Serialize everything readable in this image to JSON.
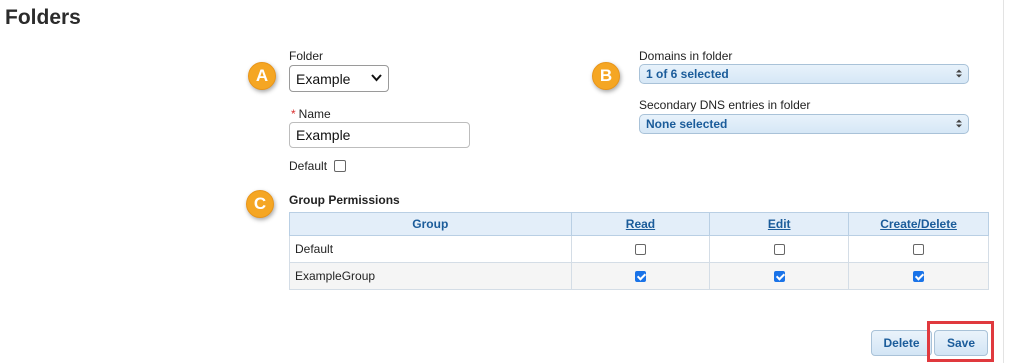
{
  "page": {
    "title": "Folders"
  },
  "annotations": {
    "badge_a": "A",
    "badge_b": "B",
    "badge_c": "C"
  },
  "form": {
    "folder_label": "Folder",
    "folder_value": "Example",
    "name_required_mark": "*",
    "name_label": "Name",
    "name_value": "Example",
    "default_label": "Default",
    "default_checked": false,
    "domains_label": "Domains in folder",
    "domains_value": "1 of 6 selected",
    "secondary_label": "Secondary DNS entries in folder",
    "secondary_value": "None selected"
  },
  "permissions": {
    "title": "Group Permissions",
    "columns": [
      "Group",
      "Read",
      "Edit",
      "Create/Delete"
    ],
    "rows": [
      {
        "group": "Default",
        "read": false,
        "edit": false,
        "create_delete": false
      },
      {
        "group": "ExampleGroup",
        "read": true,
        "edit": true,
        "create_delete": true
      }
    ]
  },
  "buttons": {
    "delete": "Delete",
    "save": "Save"
  },
  "colors": {
    "badge": "#f5a623",
    "highlight": "#e0393e",
    "accent": "#1b5c9a",
    "checkbox": "#1a73e8"
  },
  "icons": {
    "folder_select": "chevron-down-icon",
    "multiselect": "up-down-arrows-icon"
  }
}
